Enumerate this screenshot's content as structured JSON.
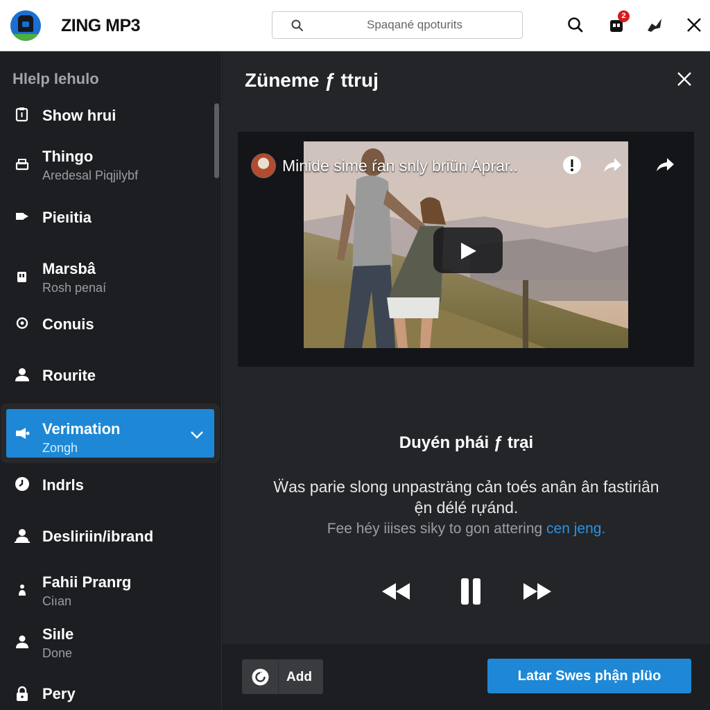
{
  "app": {
    "brand": "ZING MP3"
  },
  "search": {
    "placeholder": "Spaqané qpoturits"
  },
  "toolbar": {
    "notification_count": "2"
  },
  "sidebar": {
    "title": "Hlelp Iehulo",
    "items": [
      {
        "label": "Show hrui",
        "sub": ""
      },
      {
        "label": "Thingo",
        "sub": "Aredesal Piqjilybf"
      },
      {
        "label": "Pieıitia",
        "sub": ""
      },
      {
        "label": "Marsbâ",
        "sub": "Rosh penaí"
      },
      {
        "label": "Conuis",
        "sub": ""
      },
      {
        "label": "Rourite",
        "sub": ""
      },
      {
        "label": "Verimation",
        "sub": "Zongh"
      },
      {
        "label": "Indrls",
        "sub": ""
      },
      {
        "label": "Desliriin/ibrand",
        "sub": ""
      },
      {
        "label": "Fahii Pranrg",
        "sub": "Ciıan"
      },
      {
        "label": "Siıle",
        "sub": "Done"
      },
      {
        "label": "Pery",
        "sub": ""
      }
    ]
  },
  "panel": {
    "title": "Zünemе ƒ ttruj",
    "video": {
      "title": "Minide sime ŕan snly briün Aprar.."
    },
    "song_title": "Duyén phái ƒ trại",
    "desc_line1": "Ẅas parie slong unpasträng cản toés anân ân fastiriân",
    "desc_line2": "ện délé rựánd.",
    "desc_line3": "Fee héy iiises siky to gon attering",
    "desc_link": "cen jeng.",
    "add_label": "Add",
    "cta_label": "Latar Swes phận plüo"
  },
  "colors": {
    "accent": "#1e88d6",
    "badge": "#d51c1c",
    "sidebar_bg": "#1d1e21",
    "panel_bg": "#242528"
  }
}
